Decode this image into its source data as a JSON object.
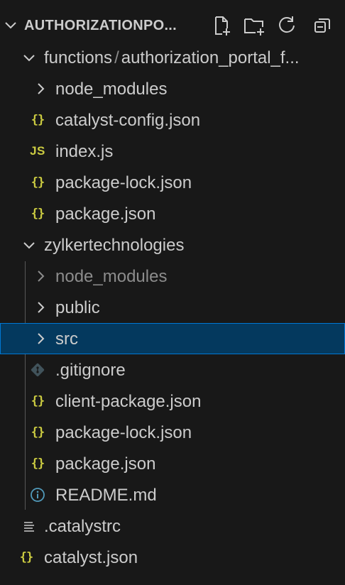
{
  "explorer": {
    "project_title": "AUTHORIZATIONPO...",
    "actions": [
      "new-file-icon",
      "new-folder-icon",
      "refresh-icon",
      "collapse-all-icon"
    ]
  },
  "tree": {
    "functions": {
      "name": "functions",
      "separator": "/",
      "child": "authorization_portal_f...",
      "items": [
        {
          "label": "node_modules",
          "icon": "chevron-right-icon"
        },
        {
          "label": "catalyst-config.json",
          "icon": "json-icon"
        },
        {
          "label": "index.js",
          "icon": "js-icon"
        },
        {
          "label": "package-lock.json",
          "icon": "json-icon"
        },
        {
          "label": "package.json",
          "icon": "json-icon"
        }
      ]
    },
    "client": {
      "name": "zylkertechnologies",
      "items": [
        {
          "label": "node_modules",
          "icon": "chevron-right-icon"
        },
        {
          "label": "public",
          "icon": "chevron-right-icon"
        },
        {
          "label": "src",
          "icon": "chevron-right-icon"
        },
        {
          "label": ".gitignore",
          "icon": "git-icon"
        },
        {
          "label": "client-package.json",
          "icon": "json-icon"
        },
        {
          "label": "package-lock.json",
          "icon": "json-icon"
        },
        {
          "label": "package.json",
          "icon": "json-icon"
        },
        {
          "label": "README.md",
          "icon": "info-icon"
        }
      ]
    },
    "root_files": [
      {
        "label": ".catalystrc",
        "icon": "lines-icon"
      },
      {
        "label": "catalyst.json",
        "icon": "json-icon"
      }
    ]
  },
  "icon_glyphs": {
    "json": "{}",
    "js": "JS"
  },
  "colors": {
    "json_icon": "#cbcb41",
    "info_icon": "#519aba",
    "selection": "#04395e",
    "selection_border": "#0078d4"
  }
}
